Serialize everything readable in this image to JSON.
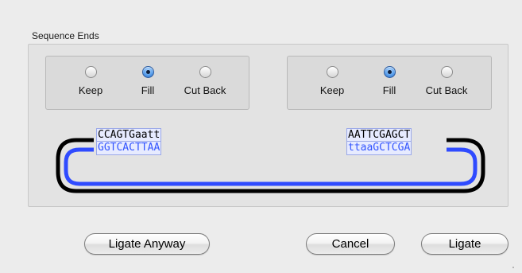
{
  "group_title": "Sequence Ends",
  "left_end": {
    "options": [
      "Keep",
      "Fill",
      "Cut Back"
    ],
    "selected": "Fill",
    "top_strand": "CCAGTGaatt",
    "bottom_strand": "GGTCACTTAA"
  },
  "right_end": {
    "options": [
      "Keep",
      "Fill",
      "Cut Back"
    ],
    "selected": "Fill",
    "top_strand": "AATTCGAGCT",
    "bottom_strand": "ttaaGCTCGA"
  },
  "buttons": {
    "ligate_anyway": "Ligate Anyway",
    "cancel": "Cancel",
    "ligate": "Ligate"
  },
  "colors": {
    "top_strand": "#000000",
    "bottom_strand": "#2f4bff",
    "selected_radio": "#4a8fe0"
  }
}
